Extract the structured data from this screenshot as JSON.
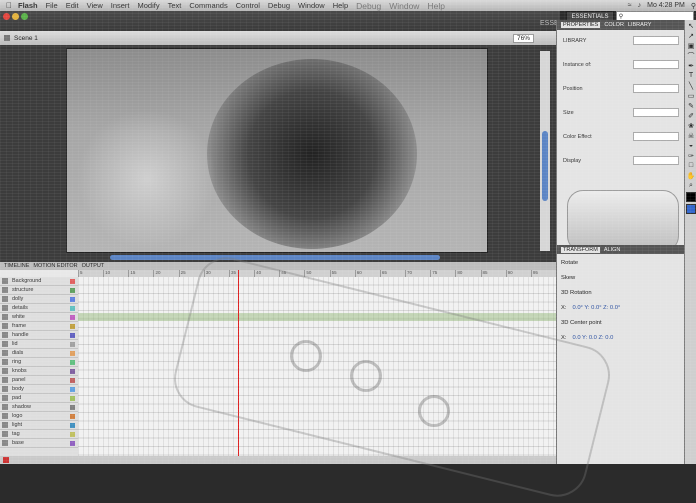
{
  "menubar": {
    "items": [
      {
        "label": "Flash",
        "bold": true
      },
      {
        "label": "File"
      },
      {
        "label": "Edit"
      },
      {
        "label": "View"
      },
      {
        "label": "Insert"
      },
      {
        "label": "Modify"
      },
      {
        "label": "Text"
      },
      {
        "label": "Commands"
      },
      {
        "label": "Control"
      },
      {
        "label": "Debug"
      },
      {
        "label": "Window"
      },
      {
        "label": "Help"
      }
    ],
    "ghost_items": [
      "Debug",
      "Window",
      "Help"
    ],
    "clock": "Mo 4:28 PM"
  },
  "header": {
    "workspace": "ESSENTIALS",
    "workspace_ghost": "ESSENTIALS"
  },
  "stage": {
    "scene_label": "Scene 1",
    "zoom": "76%"
  },
  "timeline": {
    "tabs": [
      "TIMELINE",
      "MOTION EDITOR",
      "OUTPUT"
    ],
    "ruler": [
      "5",
      "10",
      "15",
      "20",
      "25",
      "30",
      "35",
      "40",
      "45",
      "50",
      "55",
      "60",
      "65",
      "70",
      "75",
      "80",
      "85",
      "90",
      "95"
    ],
    "layers": [
      {
        "name": "Background",
        "color": "#e06060"
      },
      {
        "name": "structure",
        "color": "#60a060"
      },
      {
        "name": "dolly",
        "color": "#6080e0"
      },
      {
        "name": "details",
        "color": "#60c0c0"
      },
      {
        "name": "white",
        "color": "#c060c0"
      },
      {
        "name": "frame",
        "color": "#c0a040"
      },
      {
        "name": "handle",
        "color": "#6060c0"
      },
      {
        "name": "lid",
        "color": "#a0a0a0"
      },
      {
        "name": "dials",
        "color": "#e0a060"
      },
      {
        "name": "ring",
        "color": "#60c080"
      },
      {
        "name": "knobs",
        "color": "#8060a0"
      },
      {
        "name": "panel",
        "color": "#c06060"
      },
      {
        "name": "body",
        "color": "#60a0e0"
      },
      {
        "name": "pad",
        "color": "#a0c060"
      },
      {
        "name": "shadow",
        "color": "#808080"
      },
      {
        "name": "logo",
        "color": "#d08040"
      },
      {
        "name": "light",
        "color": "#4090c0"
      },
      {
        "name": "tag",
        "color": "#c0c060"
      },
      {
        "name": "base",
        "color": "#9060c0"
      }
    ]
  },
  "panels": {
    "tabs": [
      "PROPERTIES",
      "COLOR",
      "LIBRARY"
    ],
    "props": [
      "LIBRARY",
      "Instance of:",
      "Position",
      "Size",
      "Color Effect",
      "Display"
    ],
    "transform_tabs": [
      "TRANSFORM",
      "ALIGN"
    ],
    "transform": [
      {
        "label": "Rotate",
        "value": ""
      },
      {
        "label": "Skew",
        "value": ""
      },
      {
        "label": "3D Rotation",
        "value": ""
      },
      {
        "label": "X:",
        "value": "0.0°   Y: 0.0°   Z: 0.0°"
      },
      {
        "label": "3D Center point",
        "value": ""
      },
      {
        "label": "X:",
        "value": "0.0   Y: 0.0   Z: 0.0"
      }
    ]
  },
  "tools": [
    "arrow-icon",
    "subselect-icon",
    "free-transform-icon",
    "lasso-icon",
    "pen-icon",
    "text-icon",
    "line-icon",
    "rect-icon",
    "pencil-icon",
    "brush-icon",
    "deco-icon",
    "bone-icon",
    "paint-bucket-icon",
    "eyedropper-icon",
    "eraser-icon",
    "hand-icon",
    "zoom-icon"
  ],
  "colors": {
    "accent": "#5b84c4",
    "stroke": "#000000",
    "fill": "#3366cc",
    "playhead": "#dd2222"
  }
}
